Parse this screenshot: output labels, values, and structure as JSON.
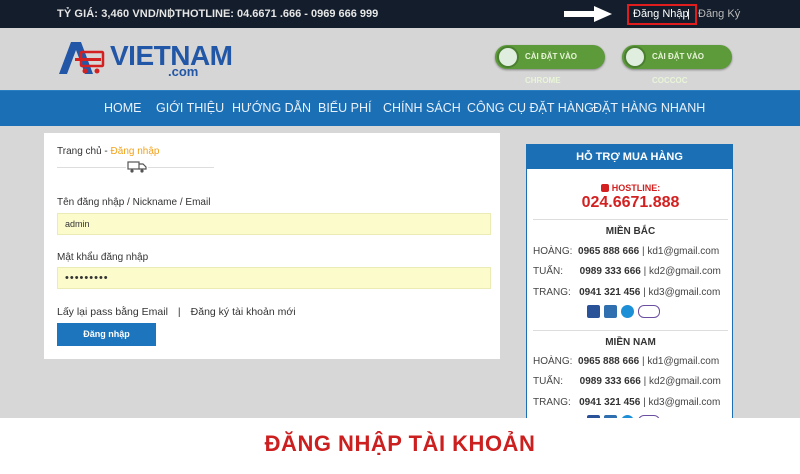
{
  "topbar": {
    "exchange_rate": "TỶ GIÁ: 3,460 VND/NDT",
    "separator": "|",
    "hotline": "HOTLINE: 04.6671 .666 - 0969 666 999",
    "login_label": "Đăng Nhập",
    "register_label": "Đăng Ký"
  },
  "header": {
    "logo_brand": "VIETNAM",
    "logo_suffix": ".com",
    "chrome_button": "CÀI ĐẶT VÀO CHROME",
    "coccoc_button": "CÀI ĐẶT VÀO COCCOC"
  },
  "nav": {
    "items": [
      "HOME",
      "GIỚI THIỆU",
      "HƯỚNG DẪN",
      "BIỂU PHÍ",
      "CHÍNH SÁCH",
      "CÔNG CỤ ĐẶT HÀNG",
      "ĐẶT HÀNG NHANH"
    ]
  },
  "login": {
    "breadcrumb_home": "Trang chủ",
    "breadcrumb_sep": " - ",
    "breadcrumb_current": "Đăng nhập",
    "username_label": "Tên đăng nhập / Nickname / Email",
    "username_value": "admin",
    "password_label": "Mật khẩu đăng nhập",
    "password_value": "•••••••••",
    "forgot_link": "Lấy lại pass bằng Email",
    "separator": "|",
    "register_link": "Đăng ký tài khoản mới",
    "submit_label": "Đăng nhập"
  },
  "support": {
    "title": "HỖ TRỢ MUA HÀNG",
    "hotline_label": "HOSTLINE:",
    "hotline_number": "024.6671.888",
    "regions": [
      {
        "name": "MIỀN BẮC",
        "contacts": [
          {
            "name": "HOÀNG:",
            "phone": "0965 888 666",
            "email": "| kd1@gmail.com"
          },
          {
            "name": "TUẤN:",
            "phone": "0989 333 666",
            "email": "| kd2@gmail.com"
          },
          {
            "name": "TRANG:",
            "phone": "0941 321 456",
            "email": "| kd3@gmail.com"
          }
        ]
      },
      {
        "name": "MIỀN NAM",
        "contacts": [
          {
            "name": "HOÀNG:",
            "phone": "0965 888 666",
            "email": "| kd1@gmail.com"
          },
          {
            "name": "TUẤN:",
            "phone": "0989 333 666",
            "email": "| kd2@gmail.com"
          },
          {
            "name": "TRANG:",
            "phone": "0941 321 456",
            "email": "| kd3@gmail.com"
          }
        ]
      }
    ]
  },
  "caption": "ĐĂNG NHẬP TÀI KHOẢN"
}
